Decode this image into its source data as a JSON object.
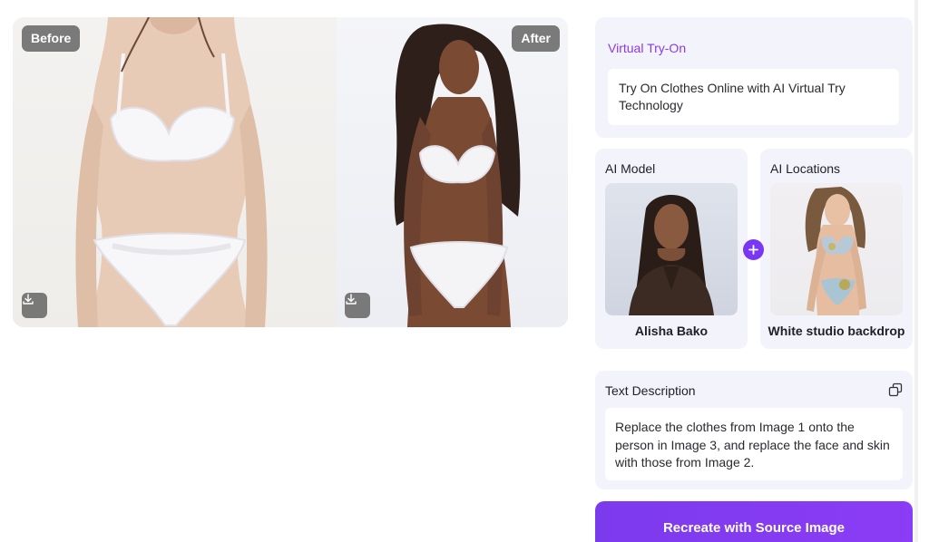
{
  "compare": {
    "before_label": "Before",
    "after_label": "After"
  },
  "virtual_tryon": {
    "title": "Virtual Try-On",
    "description": "Try On Clothes Online with AI Virtual Try Technology"
  },
  "ai_model": {
    "label": "AI Model",
    "name": "Alisha Bako"
  },
  "ai_locations": {
    "label": "AI Locations",
    "name": "White studio backdrop"
  },
  "text_description": {
    "title": "Text Description",
    "text": "Replace the clothes from Image 1 onto the person in Image 3, and replace the face and skin with those from Image 2."
  },
  "cta": {
    "label": "Recreate with Source Image"
  },
  "colors": {
    "accent": "#7a36f2",
    "title_purple": "#8a3be8",
    "card_bg": "#f3f3fb"
  },
  "icons": [
    "download-icon",
    "plus-icon",
    "copy-icon"
  ]
}
